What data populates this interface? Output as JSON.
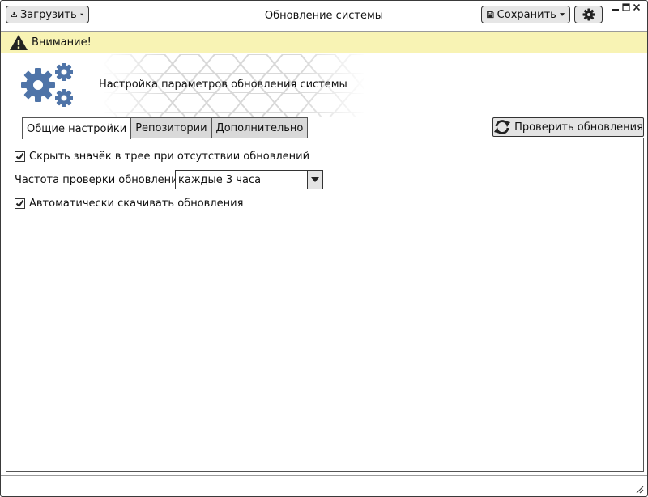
{
  "window": {
    "title": "Обновление системы"
  },
  "toolbar": {
    "load_label": "Загрузить",
    "save_label": "Сохранить",
    "icons": {
      "load": "download-icon",
      "save": "floppy-disk-icon",
      "settings": "gear-icon",
      "dropdown": "chevron-down-icon"
    }
  },
  "warning": {
    "text": "Внимание!",
    "background": "#f8f3b4"
  },
  "banner": {
    "title": "Настройка параметров обновления системы",
    "icon": "gears-icon",
    "icon_color": "#4f74a8"
  },
  "tabs": [
    {
      "label": "Общие настройки",
      "active": true
    },
    {
      "label": "Репозитории",
      "active": false
    },
    {
      "label": "Дополнительно",
      "active": false
    }
  ],
  "check_updates": {
    "label": "Проверить обновления",
    "icon": "refresh-icon"
  },
  "general": {
    "hide_tray_icon": {
      "label": "Скрыть значёк в трее при отсутствии обновлений",
      "checked": true
    },
    "frequency": {
      "label": "Частота проверки обновлений",
      "value": "каждые 3 часа"
    },
    "auto_download": {
      "label": "Автоматически скачивать обновления",
      "checked": true
    }
  }
}
